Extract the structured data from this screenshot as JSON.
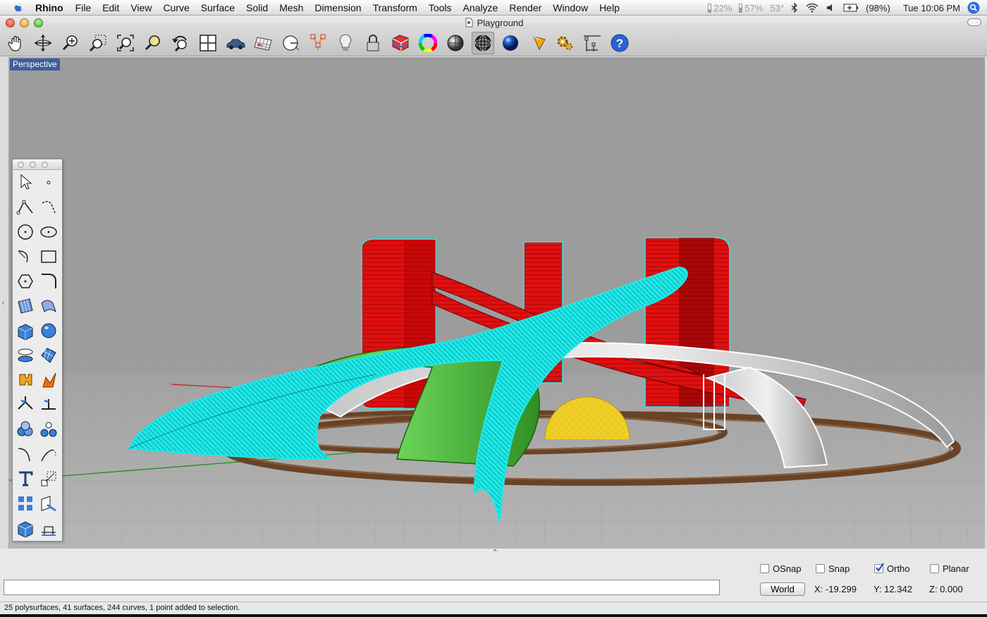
{
  "menubar": {
    "app": "Rhino",
    "items": [
      "File",
      "Edit",
      "View",
      "Curve",
      "Surface",
      "Solid",
      "Mesh",
      "Dimension",
      "Transform",
      "Tools",
      "Analyze",
      "Render",
      "Window",
      "Help"
    ],
    "status": {
      "cpu1": "22%",
      "cpu2": "57%",
      "temp": "53°",
      "battery": "(98%)",
      "clock": "Tue 10:06 PM"
    }
  },
  "window": {
    "title": "Playground"
  },
  "toolbar": {
    "icons": [
      "pan-hand-icon",
      "rotate-view-icon",
      "zoom-icon",
      "zoom-window-icon",
      "zoom-extents-icon",
      "zoom-selected-icon",
      "undo-view-icon",
      "four-viewports-icon",
      "car-icon",
      "grid-plane-icon",
      "cplane-icon",
      "osnap-icon",
      "light-bulb-icon",
      "lock-icon",
      "layer-book-icon",
      "color-wheel-icon",
      "shaded-sphere-icon",
      "wireframe-sphere-icon",
      "render-sphere-icon",
      "render-cone-icon",
      "options-gear-icon",
      "dimension-icon",
      "help-icon"
    ]
  },
  "viewport": {
    "label": "Perspective"
  },
  "palette": {
    "tools": [
      "select-arrow-icon",
      "point-icon",
      "polyline-icon",
      "curve-icon",
      "circle-icon",
      "ellipse-icon",
      "arc-icon",
      "rectangle-icon",
      "polygon-icon",
      "fillet-curve-icon",
      "surface-patch-icon",
      "extrude-surface-icon",
      "box-icon",
      "sphere-icon",
      "cylinder-icon",
      "surface-grid-icon",
      "boolean-puzzle-icon",
      "shard-icon",
      "split-icon",
      "trim-icon",
      "group-icon",
      "ungroup-icon",
      "curve-offset-icon",
      "curve-extend-icon",
      "text-icon",
      "scale-icon",
      "array-icon",
      "transform-icon",
      "block-icon",
      "dimension-base-icon"
    ]
  },
  "bottom": {
    "checks": [
      {
        "label": "OSnap",
        "checked": false
      },
      {
        "label": "Snap",
        "checked": false
      },
      {
        "label": "Ortho",
        "checked": true
      },
      {
        "label": "Planar",
        "checked": false
      }
    ],
    "world_button": "World",
    "x": "X: -19.299",
    "y": "Y: 12.342",
    "z": "Z: 0.000",
    "status": "25 polysurfaces, 41 surfaces, 244 curves, 1 point added to selection."
  },
  "colors": {
    "red": "#e01010",
    "cyan": "#1ee8e8",
    "green": "#3dbb2e",
    "yellow": "#f0d02a",
    "brown": "#6a4326",
    "white": "#f2f2f2"
  }
}
